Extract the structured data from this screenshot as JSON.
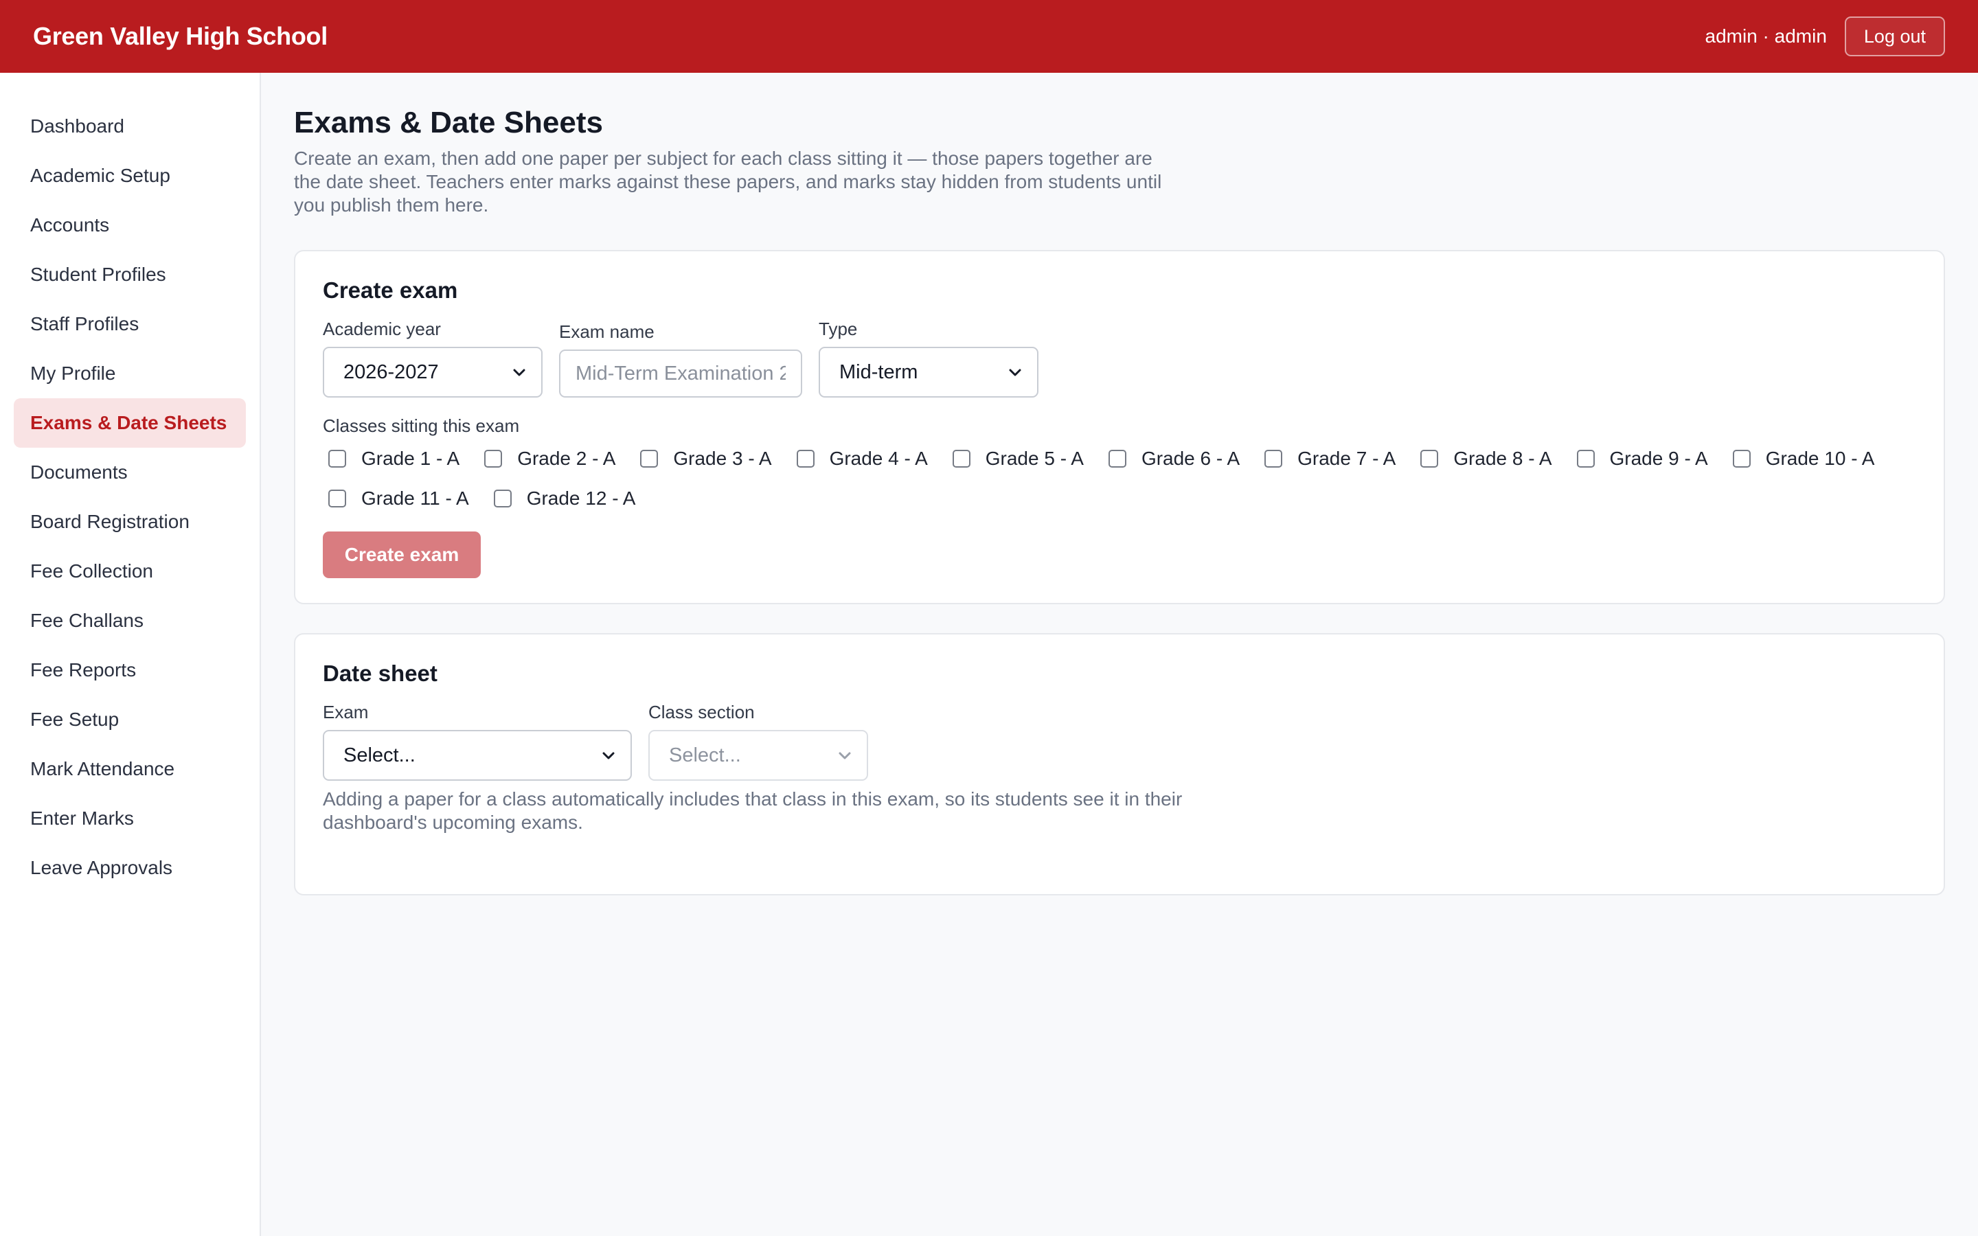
{
  "header": {
    "brand": "Green Valley High School",
    "user_label": "admin · admin",
    "logout_label": "Log out"
  },
  "sidebar": {
    "items": [
      {
        "label": "Dashboard",
        "active": false
      },
      {
        "label": "Academic Setup",
        "active": false
      },
      {
        "label": "Accounts",
        "active": false
      },
      {
        "label": "Student Profiles",
        "active": false
      },
      {
        "label": "Staff Profiles",
        "active": false
      },
      {
        "label": "My Profile",
        "active": false
      },
      {
        "label": "Exams & Date Sheets",
        "active": true
      },
      {
        "label": "Documents",
        "active": false
      },
      {
        "label": "Board Registration",
        "active": false
      },
      {
        "label": "Fee Collection",
        "active": false
      },
      {
        "label": "Fee Challans",
        "active": false
      },
      {
        "label": "Fee Reports",
        "active": false
      },
      {
        "label": "Fee Setup",
        "active": false
      },
      {
        "label": "Mark Attendance",
        "active": false
      },
      {
        "label": "Enter Marks",
        "active": false
      },
      {
        "label": "Leave Approvals",
        "active": false
      }
    ]
  },
  "page": {
    "title": "Exams & Date Sheets",
    "description": "Create an exam, then add one paper per subject for each class sitting it — those papers together are the date sheet. Teachers enter marks against these papers, and marks stay hidden from students until you publish them here."
  },
  "create_exam": {
    "title": "Create exam",
    "academic_year_label": "Academic year",
    "academic_year_value": "2026-2027",
    "exam_name_label": "Exam name",
    "exam_name_placeholder": "Mid-Term Examination 2",
    "type_label": "Type",
    "type_value": "Mid-term",
    "classes_label": "Classes sitting this exam",
    "classes": [
      {
        "label": "Grade 1 - A",
        "checked": false
      },
      {
        "label": "Grade 2 - A",
        "checked": false
      },
      {
        "label": "Grade 3 - A",
        "checked": false
      },
      {
        "label": "Grade 4 - A",
        "checked": false
      },
      {
        "label": "Grade 5 - A",
        "checked": false
      },
      {
        "label": "Grade 6 - A",
        "checked": false
      },
      {
        "label": "Grade 7 - A",
        "checked": false
      },
      {
        "label": "Grade 8 - A",
        "checked": false
      },
      {
        "label": "Grade 9 - A",
        "checked": false
      },
      {
        "label": "Grade 10 - A",
        "checked": false
      },
      {
        "label": "Grade 11 - A",
        "checked": false
      },
      {
        "label": "Grade 12 - A",
        "checked": false
      }
    ],
    "submit_label": "Create exam"
  },
  "date_sheet": {
    "title": "Date sheet",
    "exam_label": "Exam",
    "exam_value": "Select...",
    "class_section_label": "Class section",
    "class_section_value": "Select...",
    "hint": "Adding a paper for a class automatically includes that class in this exam, so its students see it in their dashboard's upcoming exams."
  },
  "colors": {
    "brand": "#b91c1f",
    "active_nav_bg": "#f9e3e4",
    "button_disabled": "#d97c80"
  },
  "icons": {
    "select_arrow": "chevron-down-icon"
  }
}
